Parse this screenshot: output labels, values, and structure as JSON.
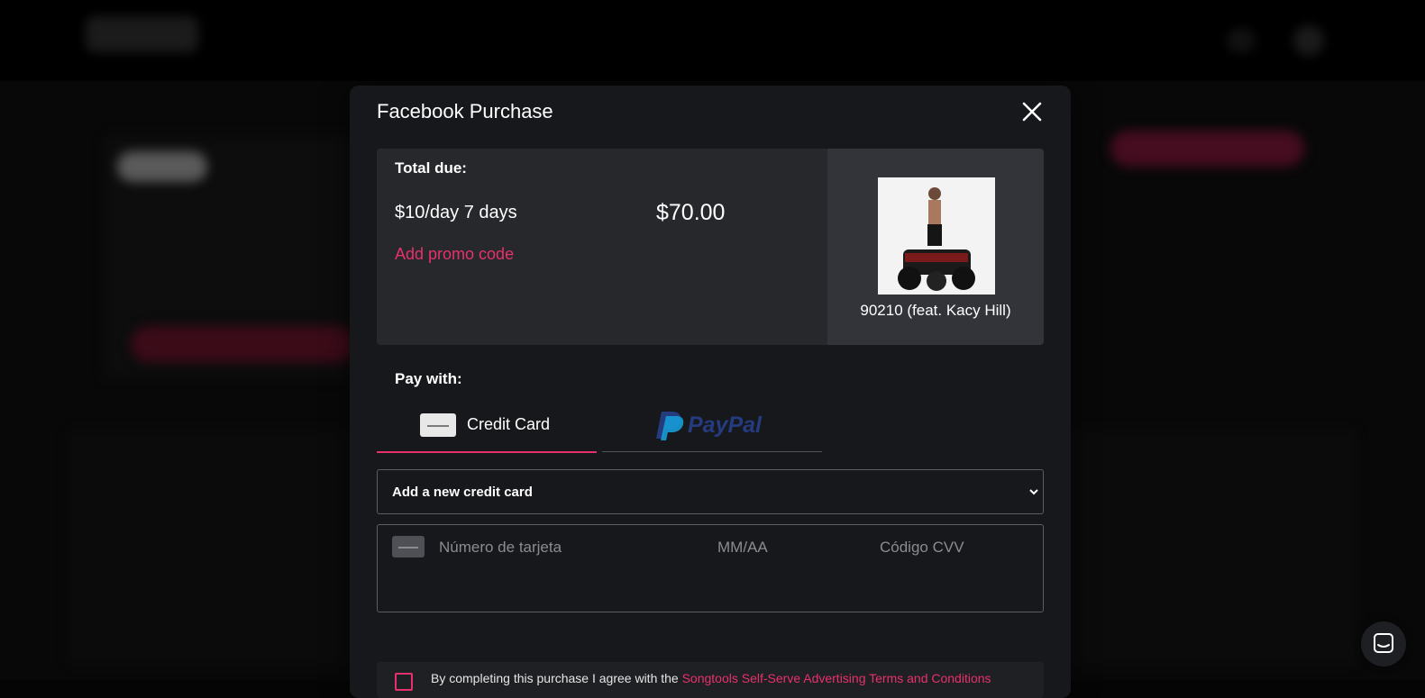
{
  "modal": {
    "title": "Facebook Purchase",
    "close_icon": "close-icon"
  },
  "summary": {
    "total_due_label": "Total due:",
    "plan_label": "$10/day 7 days",
    "plan_price": "$70.00",
    "promo_link": "Add promo code",
    "track_title": "90210 (feat. Kacy Hill)"
  },
  "payment": {
    "pay_with_label": "Pay with:",
    "tabs": [
      {
        "label": "Credit Card",
        "icon": "credit-card-icon",
        "selected": true
      },
      {
        "label": "PayPal",
        "icon": "paypal-logo",
        "selected": false
      }
    ],
    "card_select": {
      "selected": "Add a new credit card"
    },
    "card_fields": {
      "number_placeholder": "Número de tarjeta",
      "expiry_placeholder": "MM/AA",
      "cvv_placeholder": "Código CVV"
    }
  },
  "terms": {
    "prefix": "By completing this purchase I agree with the",
    "link": "Songtools Self-Serve Advertising Terms and Conditions"
  },
  "colors": {
    "accent": "#e8316b",
    "modal_bg": "#17181b",
    "panel_bg": "#26282c",
    "paypal_dark": "#253b80",
    "paypal_light": "#179bd7"
  }
}
